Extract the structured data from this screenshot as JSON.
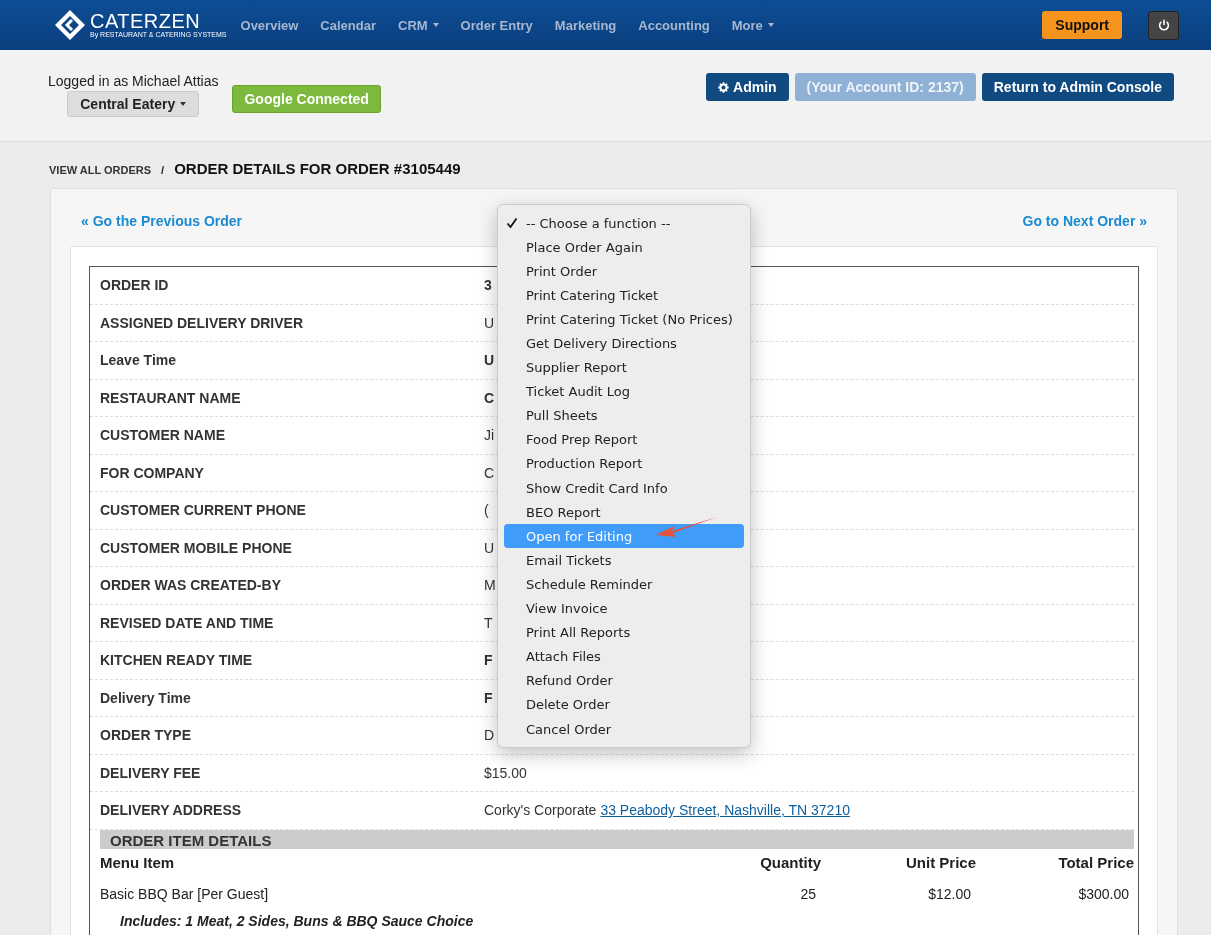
{
  "nav": {
    "logo": {
      "name": "CATERZEN",
      "tagline": "By RESTAURANT & CATERING SYSTEMS"
    },
    "items": [
      {
        "label": "Overview",
        "has_caret": false
      },
      {
        "label": "Calendar",
        "has_caret": false
      },
      {
        "label": "CRM",
        "has_caret": true
      },
      {
        "label": "Order Entry",
        "has_caret": false
      },
      {
        "label": "Marketing",
        "has_caret": false
      },
      {
        "label": "Accounting",
        "has_caret": false
      },
      {
        "label": "More",
        "has_caret": true
      }
    ],
    "support": "Support"
  },
  "header": {
    "logged_in": "Logged in as Michael Attias",
    "location": "Central Eatery",
    "google": "Google Connected",
    "buttons": [
      {
        "label": "Admin",
        "kind": "admin",
        "disabled": false
      },
      {
        "label": "(Your Account ID: 2137)",
        "kind": "plain",
        "disabled": true
      },
      {
        "label": "Return to Admin Console",
        "kind": "plain",
        "disabled": false
      }
    ]
  },
  "breadcrumb": {
    "link": "VIEW ALL ORDERS",
    "separator": "/",
    "title": "ORDER DETAILS FOR ORDER #3105449"
  },
  "pager": {
    "previous": "« Go the Previous Order",
    "next": "Go to Next Order »"
  },
  "details": [
    {
      "label": "ORDER ID",
      "value": "3",
      "bold": true
    },
    {
      "label": "ASSIGNED DELIVERY DRIVER",
      "value": "U",
      "bold": false
    },
    {
      "label": "Leave Time",
      "value": "U",
      "bold": true
    },
    {
      "label": "RESTAURANT NAME",
      "value": "C",
      "bold": true
    },
    {
      "label": "CUSTOMER NAME",
      "value": "Ji",
      "bold": false
    },
    {
      "label": "FOR COMPANY",
      "value": "C",
      "bold": false
    },
    {
      "label": "CUSTOMER CURRENT PHONE",
      "value": "(",
      "bold": false
    },
    {
      "label": "CUSTOMER MOBILE PHONE",
      "value": "U",
      "bold": false
    },
    {
      "label": "ORDER WAS CREATED-BY",
      "value": "M",
      "bold": false
    },
    {
      "label": "REVISED DATE AND TIME",
      "value": "T",
      "bold": false
    },
    {
      "label": "KITCHEN READY TIME",
      "value": "F",
      "bold": true
    },
    {
      "label": "Delivery Time",
      "value": "F",
      "bold": true
    },
    {
      "label": "ORDER TYPE",
      "value": "D",
      "bold": false
    },
    {
      "label": "DELIVERY FEE",
      "value": "$15.00",
      "bold": false
    }
  ],
  "address": {
    "label": "DELIVERY ADDRESS",
    "prefix": "Corky's Corporate",
    "link": "33 Peabody Street, Nashville, TN 37210"
  },
  "items_section": {
    "title": "ORDER ITEM DETAILS",
    "columns": [
      "Menu Item",
      "Quantity",
      "Unit Price",
      "Total Price"
    ],
    "rows": [
      {
        "cells": [
          "Basic BBQ Bar [Per Guest]",
          "25",
          "$12.00",
          "$300.00"
        ],
        "note": "Includes: 1 Meat, 2 Sides, Buns & BBQ Sauce Choice"
      }
    ]
  },
  "menu": [
    {
      "label": "-- Choose a function --",
      "checked": true,
      "highlighted": false
    },
    {
      "label": "Place Order Again",
      "checked": false,
      "highlighted": false
    },
    {
      "label": "Print Order",
      "checked": false,
      "highlighted": false
    },
    {
      "label": "Print Catering Ticket",
      "checked": false,
      "highlighted": false
    },
    {
      "label": "Print Catering Ticket (No Prices)",
      "checked": false,
      "highlighted": false
    },
    {
      "label": "Get Delivery Directions",
      "checked": false,
      "highlighted": false
    },
    {
      "label": "Supplier Report",
      "checked": false,
      "highlighted": false
    },
    {
      "label": "Ticket Audit Log",
      "checked": false,
      "highlighted": false
    },
    {
      "label": "Pull Sheets",
      "checked": false,
      "highlighted": false
    },
    {
      "label": "Food Prep Report",
      "checked": false,
      "highlighted": false
    },
    {
      "label": "Production Report",
      "checked": false,
      "highlighted": false
    },
    {
      "label": "Show Credit Card Info",
      "checked": false,
      "highlighted": false
    },
    {
      "label": "BEO Report",
      "checked": false,
      "highlighted": false
    },
    {
      "label": "Open for Editing",
      "checked": false,
      "highlighted": true
    },
    {
      "label": "Email Tickets",
      "checked": false,
      "highlighted": false
    },
    {
      "label": "Schedule Reminder",
      "checked": false,
      "highlighted": false
    },
    {
      "label": "View Invoice",
      "checked": false,
      "highlighted": false
    },
    {
      "label": "Print All Reports",
      "checked": false,
      "highlighted": false
    },
    {
      "label": "Attach Files",
      "checked": false,
      "highlighted": false
    },
    {
      "label": "Refund Order",
      "checked": false,
      "highlighted": false
    },
    {
      "label": "Delete Order",
      "checked": false,
      "highlighted": false
    },
    {
      "label": "Cancel Order",
      "checked": false,
      "highlighted": false
    }
  ]
}
